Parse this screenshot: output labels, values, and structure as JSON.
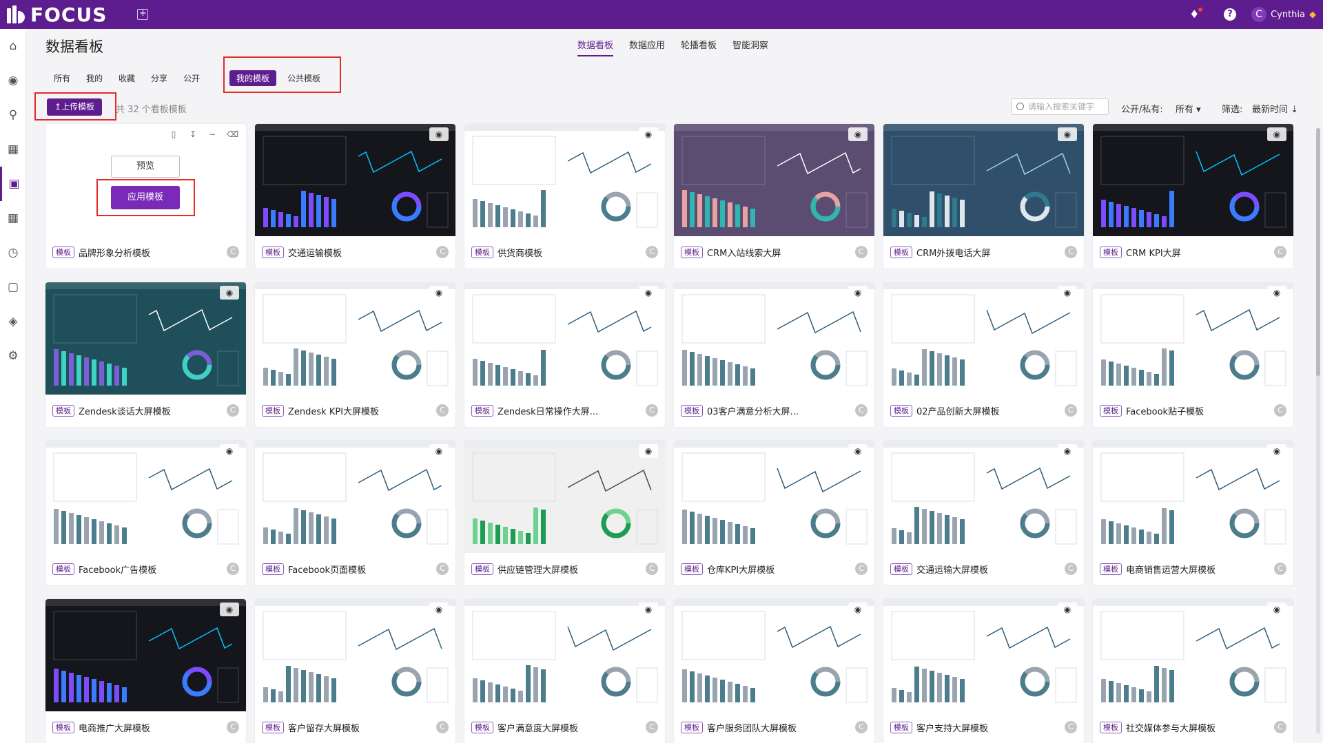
{
  "app": {
    "brand": "FOCUS",
    "accent": "#5e1d8e"
  },
  "user": {
    "initial": "C",
    "name": "Cynthia"
  },
  "page": {
    "title": "数据看板"
  },
  "main_tabs": [
    {
      "label": "数据看板",
      "active": true
    },
    {
      "label": "数据应用",
      "active": false
    },
    {
      "label": "轮播看板",
      "active": false
    },
    {
      "label": "智能洞察",
      "active": false
    }
  ],
  "filter_tabs": [
    "所有",
    "我的",
    "收藏",
    "分享",
    "公开"
  ],
  "template_tabs": [
    {
      "label": "我的模板",
      "active": true
    },
    {
      "label": "公共模板",
      "active": false
    }
  ],
  "upload": {
    "label": "上传模板",
    "count_text": "共 32 个看板模板"
  },
  "search": {
    "placeholder": "请输入搜索关键字"
  },
  "visibility": {
    "label": "公开/私有:",
    "value": "所有 ▾"
  },
  "filter": {
    "label": "筛选:",
    "sort": "最新时间 ⇣"
  },
  "hover_card": {
    "preview": "预览",
    "apply": "应用模板"
  },
  "tag_label": "模板",
  "badge": "C",
  "cards": [
    {
      "name": "品牌形象分析模板",
      "theme": "white"
    },
    {
      "name": "交通运输模板",
      "theme": "dark"
    },
    {
      "name": "供货商模板",
      "theme": "white"
    },
    {
      "name": "CRM入站线索大屏",
      "theme": "sunset"
    },
    {
      "name": "CRM外拨电话大屏",
      "theme": "blue"
    },
    {
      "name": "CRM KPI大屏",
      "theme": "dark"
    },
    {
      "name": "Zendesk谈话大屏模板",
      "theme": "teal"
    },
    {
      "name": "Zendesk KPI大屏模板",
      "theme": "white"
    },
    {
      "name": "Zendesk日常操作大屏...",
      "theme": "white"
    },
    {
      "name": "03客户满意分析大屏...",
      "theme": "white"
    },
    {
      "name": "02产品创新大屏模板",
      "theme": "white"
    },
    {
      "name": "Facebook贴子模板",
      "theme": "white"
    },
    {
      "name": "Facebook广告模板",
      "theme": "white"
    },
    {
      "name": "Facebook页面模板",
      "theme": "white"
    },
    {
      "name": "供应链管理大屏模板",
      "theme": "grey"
    },
    {
      "name": "仓库KPI大屏模板",
      "theme": "white"
    },
    {
      "name": "交通运输大屏模板",
      "theme": "white"
    },
    {
      "name": "电商销售运营大屏模板",
      "theme": "white"
    },
    {
      "name": "电商推广大屏模板",
      "theme": "dark"
    },
    {
      "name": "客户留存大屏模板",
      "theme": "white"
    },
    {
      "name": "客户满意度大屏模板",
      "theme": "white"
    },
    {
      "name": "客户服务团队大屏模板",
      "theme": "white"
    },
    {
      "name": "客户支持大屏模板",
      "theme": "white"
    },
    {
      "name": "社交媒体参与大屏模板",
      "theme": "white"
    }
  ]
}
